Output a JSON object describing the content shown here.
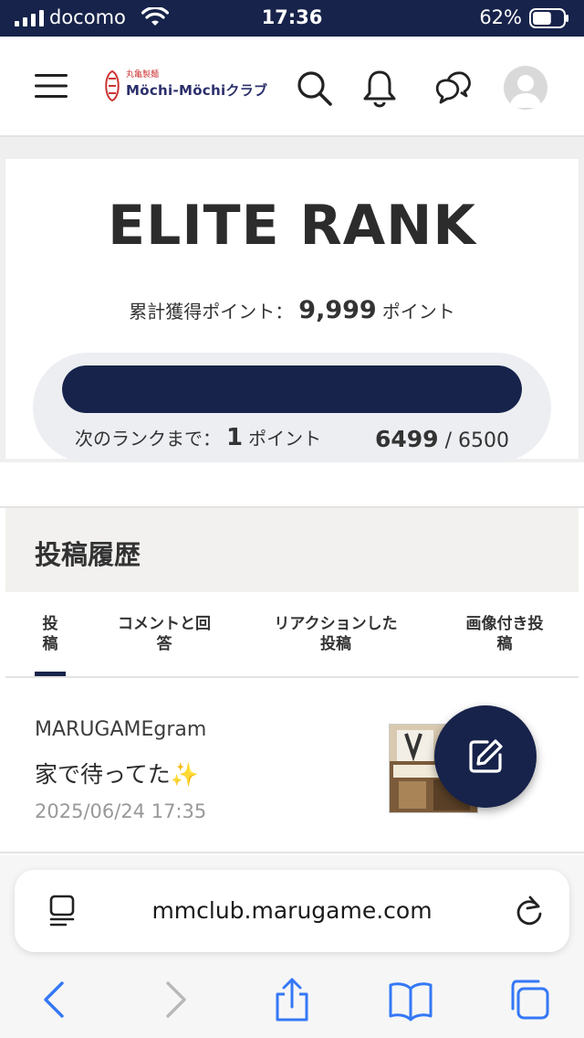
{
  "status_bar": {
    "carrier": "docomo",
    "time": "17:36",
    "battery": "62%",
    "battery_level": 0.62
  },
  "header": {
    "logo_small": "丸亀製麺",
    "logo_main": "Möchi-Möchiクラブ",
    "icons": [
      "menu-icon",
      "search-icon",
      "bell-icon",
      "chat-icon",
      "avatar-icon"
    ]
  },
  "rank": {
    "title": "ELITE RANK",
    "total_label": "累計獲得ポイント：",
    "total_value": "9,999",
    "total_unit": "ポイント",
    "next_label": "次のランクまで：",
    "next_value": "1",
    "next_unit": "ポイント",
    "progress_current": "6499",
    "progress_sep": "/",
    "progress_max": "6500",
    "progress_fraction": 0.9998
  },
  "posts": {
    "title": "投稿履歴",
    "tabs": [
      {
        "label": "投\n稿",
        "active": true
      },
      {
        "label": "コメントと回\n答",
        "active": false
      },
      {
        "label": "リアクションした\n投稿",
        "active": false
      },
      {
        "label": "画像付き投\n稿",
        "active": false
      }
    ],
    "items": [
      {
        "user": "MARUGAMEgram",
        "text": "家で待ってた✨",
        "date": "2025/06/24 17:35"
      }
    ]
  },
  "fab": {
    "icon": "edit-icon"
  },
  "browser": {
    "url": "mmclub.marugame.com",
    "colors": {
      "accent": "#3478f6",
      "navy": "#17234a"
    }
  }
}
